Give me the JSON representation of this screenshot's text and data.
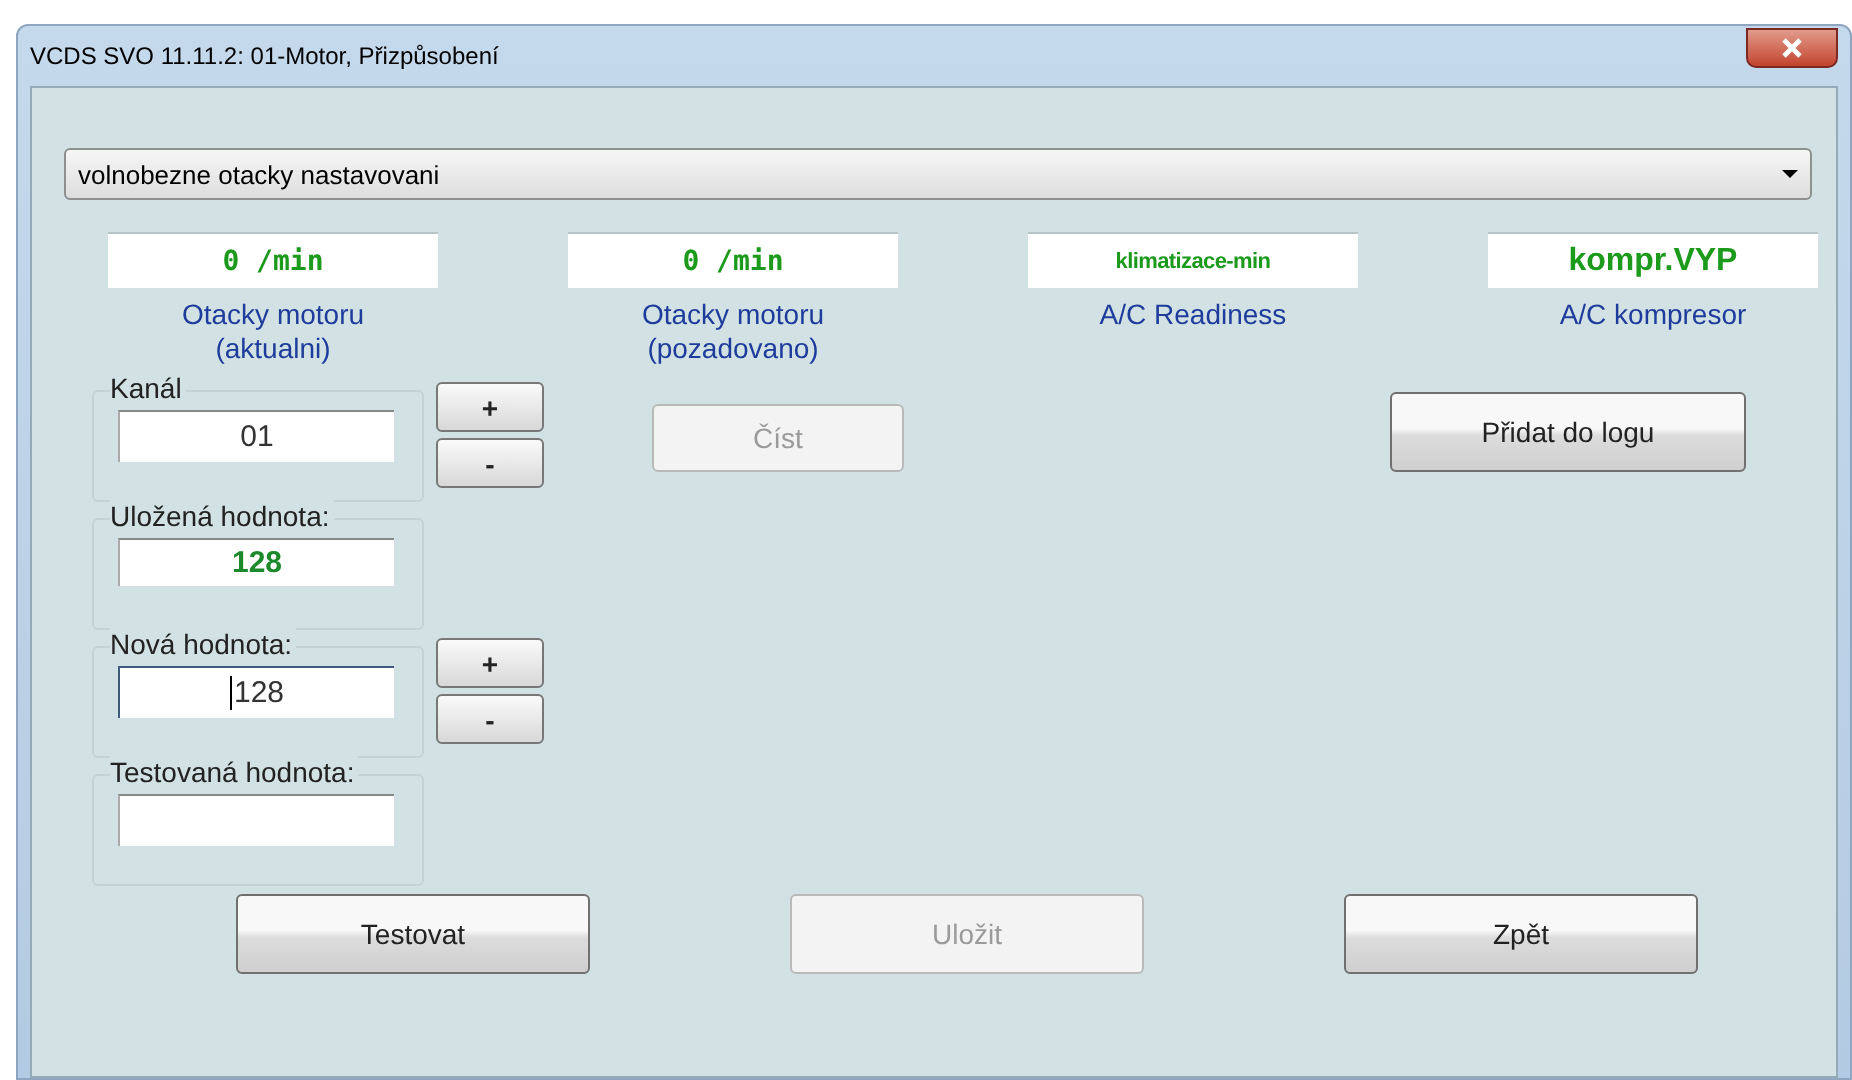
{
  "window": {
    "title": "VCDS SVO 11.11.2: 01-Motor,  Přizpůsobení"
  },
  "dropdown": {
    "value": "volnobezne otacky nastavovani"
  },
  "readouts": [
    {
      "value": "0 /min",
      "label": "Otacky motoru\n(aktualni)",
      "kind": "mono"
    },
    {
      "value": "0 /min",
      "label": "Otacky motoru\n(pozadovano)",
      "kind": "mono"
    },
    {
      "value": "klimatizace-min",
      "label": "A/C Readiness",
      "kind": "narrow"
    },
    {
      "value": "kompr.VYP",
      "label": "A/C kompresor",
      "kind": "wide"
    }
  ],
  "fields": [
    {
      "label": "Kanál",
      "value": "01",
      "kind": "spin",
      "focused": false,
      "buttons": [
        "+",
        "-"
      ]
    },
    {
      "label": "Uložená hodnota:",
      "value": "128",
      "kind": "stored",
      "focused": false
    },
    {
      "label": "Nová hodnota:",
      "value": "128",
      "kind": "spin",
      "focused": true,
      "buttons": [
        "+",
        "-"
      ]
    },
    {
      "label": "Testovaná hodnota:",
      "kind": "empty",
      "focused": false
    }
  ],
  "read_button": {
    "label": "Číst",
    "disabled": true
  },
  "log_button": {
    "label": "Přidat do logu",
    "disabled": false
  },
  "buttons": [
    {
      "label": "Testovat",
      "disabled": false
    },
    {
      "label": "Uložit",
      "disabled": true
    },
    {
      "label": "Zpět",
      "disabled": false
    }
  ]
}
